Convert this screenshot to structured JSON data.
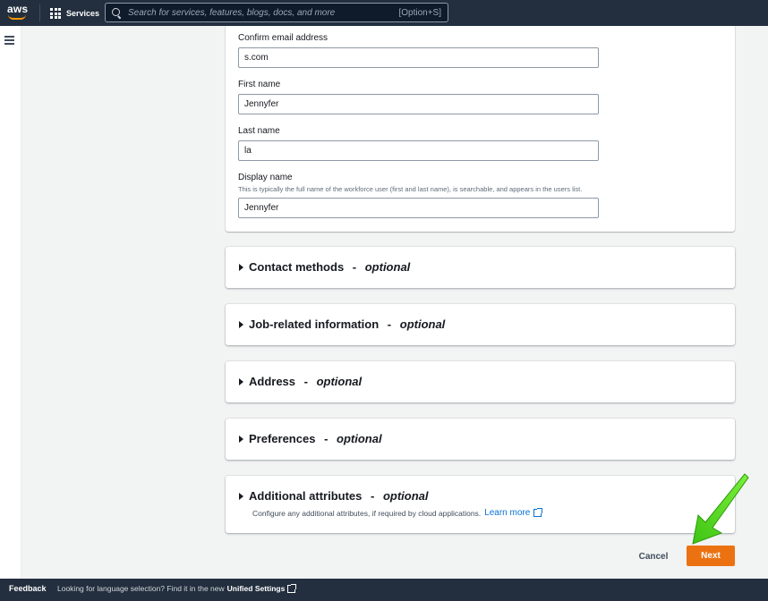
{
  "topnav": {
    "logo_text": "aws",
    "services_label": "Services",
    "search_placeholder": "Search for services, features, blogs, docs, and more",
    "search_shortcut": "[Option+S]"
  },
  "form": {
    "confirm_email": {
      "label": "Confirm email address",
      "value": "s.com"
    },
    "first_name": {
      "label": "First name",
      "value": "Jennyfer"
    },
    "last_name": {
      "label": "Last name",
      "value": "la"
    },
    "display_name": {
      "label": "Display name",
      "description": "This is typically the full name of the workforce user (first and last name), is searchable, and appears in the users list.",
      "value": "Jennyfer"
    }
  },
  "sections": [
    {
      "title": "Contact methods",
      "optional": "optional"
    },
    {
      "title": "Job-related information",
      "optional": "optional"
    },
    {
      "title": "Address",
      "optional": "optional"
    },
    {
      "title": "Preferences",
      "optional": "optional"
    },
    {
      "title": "Additional attributes",
      "optional": "optional",
      "description": "Configure any additional attributes, if required by cloud applications.",
      "learn_more": "Learn more"
    }
  ],
  "section_separator": " - ",
  "actions": {
    "cancel_label": "Cancel",
    "next_label": "Next"
  },
  "footer": {
    "feedback_label": "Feedback",
    "message": "Looking for language selection? Find it in the new",
    "unified_settings_label": "Unified Settings"
  },
  "colors": {
    "nav_bg": "#232f3e",
    "primary_button": "#ec7211",
    "link": "#0972d3",
    "annotation_arrow": "#5ee31d"
  }
}
